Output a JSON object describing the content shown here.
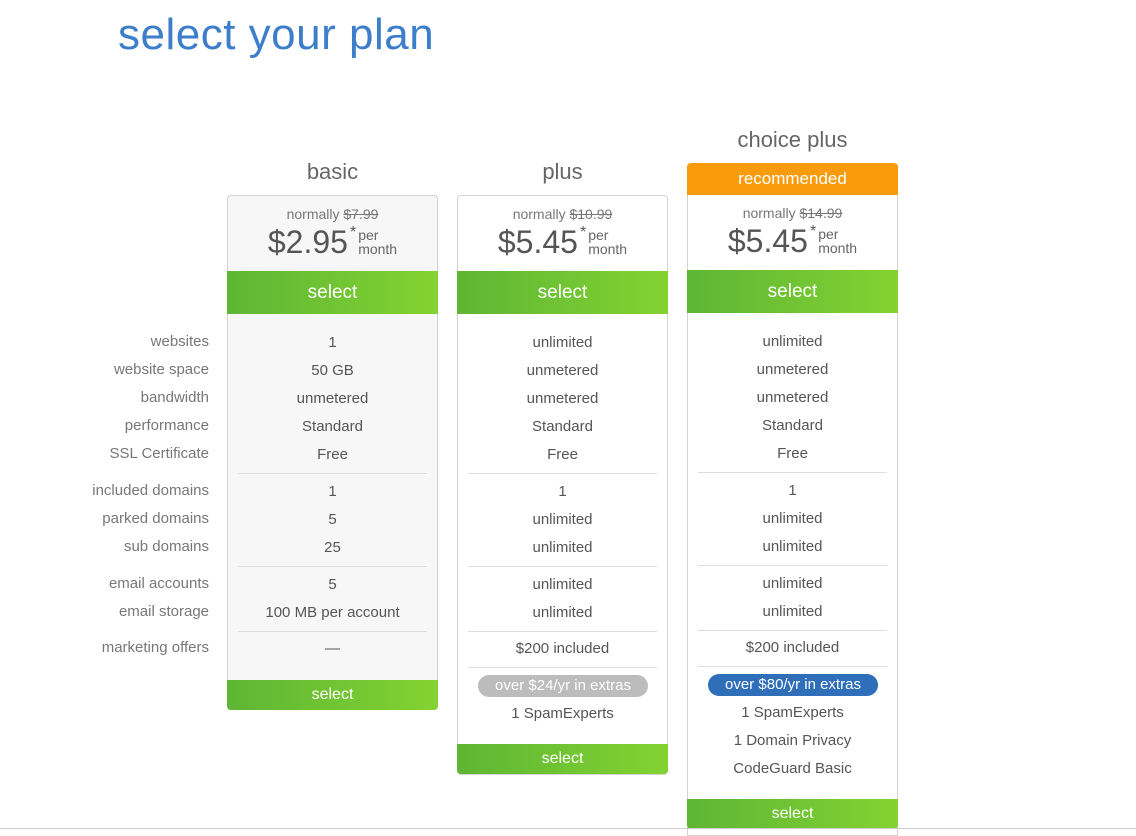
{
  "title": "select your plan",
  "feature_labels": [
    "websites",
    "website space",
    "bandwidth",
    "performance",
    "SSL Certificate",
    "included domains",
    "parked domains",
    "sub domains",
    "email accounts",
    "email storage",
    "marketing offers"
  ],
  "plans": [
    {
      "name": "basic",
      "normally_label": "normally",
      "normal_price": "$7.99",
      "currency": "$",
      "price": "2.95",
      "asterisk": "*",
      "per": "per",
      "month": "month",
      "select_label": "select",
      "values": [
        "1",
        "50 GB",
        "unmetered",
        "Standard",
        "Free",
        "1",
        "5",
        "25",
        "5",
        "100 MB per account",
        "—"
      ]
    },
    {
      "name": "plus",
      "normally_label": "normally",
      "normal_price": "$10.99",
      "currency": "$",
      "price": "5.45",
      "asterisk": "*",
      "per": "per",
      "month": "month",
      "select_label": "select",
      "values": [
        "unlimited",
        "unmetered",
        "unmetered",
        "Standard",
        "Free",
        "1",
        "unlimited",
        "unlimited",
        "unlimited",
        "unlimited",
        "$200 included"
      ],
      "extras_badge": "over $24/yr in extras",
      "extras": [
        "1 SpamExperts"
      ]
    },
    {
      "name": "choice plus",
      "badge": "recommended",
      "normally_label": "normally",
      "normal_price": "$14.99",
      "currency": "$",
      "price": "5.45",
      "asterisk": "*",
      "per": "per",
      "month": "month",
      "select_label": "select",
      "values": [
        "unlimited",
        "unmetered",
        "unmetered",
        "Standard",
        "Free",
        "1",
        "unlimited",
        "unlimited",
        "unlimited",
        "unlimited",
        "$200 included"
      ],
      "extras_badge": "over $80/yr in extras",
      "extras": [
        "1 SpamExperts",
        "1 Domain Privacy",
        "CodeGuard Basic"
      ]
    }
  ],
  "colors": {
    "title": "#3d7ecb",
    "select_green": "#6cc332",
    "recommended": "#f89c0e",
    "extras_gray": "#bcbcbc",
    "extras_blue": "#2f6eb9"
  }
}
